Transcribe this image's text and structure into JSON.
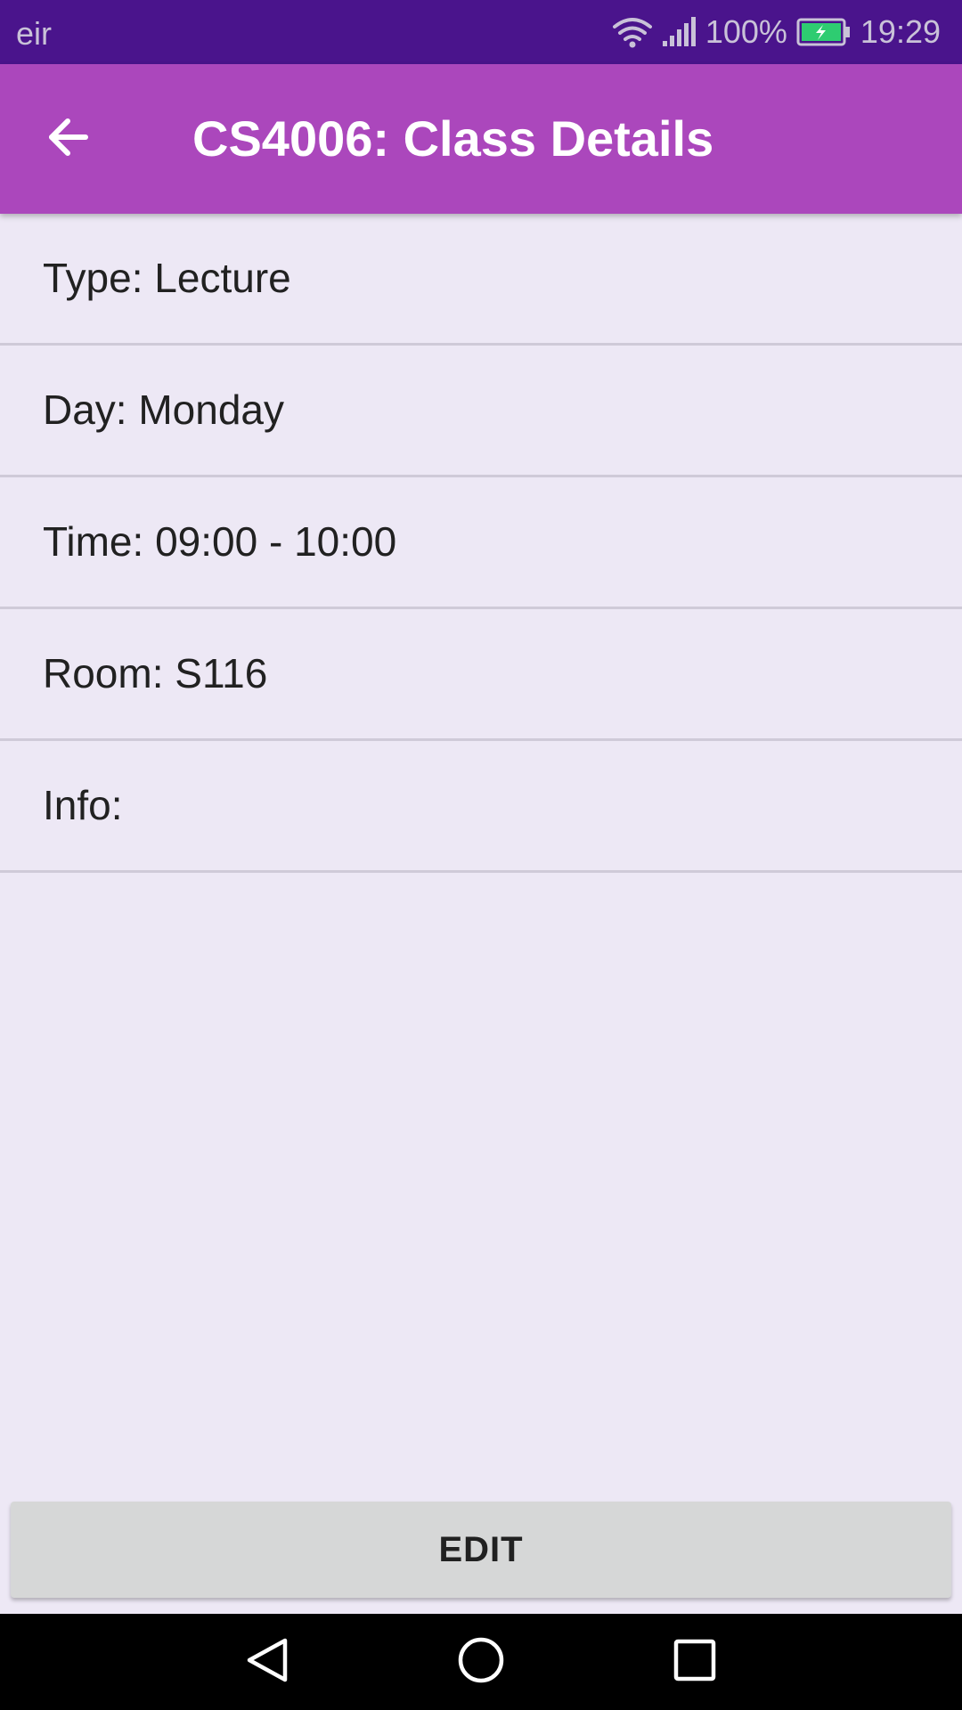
{
  "status_bar": {
    "carrier": "eir",
    "battery_percent": "100%",
    "time": "19:29",
    "icons": [
      "wifi-icon",
      "signal-icon",
      "battery-charging-icon"
    ],
    "battery_color": "#2ecc71"
  },
  "app_bar": {
    "title": "CS4006: Class Details",
    "back_icon": "arrow-back-icon",
    "color": "#ab47bc"
  },
  "details": {
    "items": [
      {
        "label": "Type: Lecture"
      },
      {
        "label": "Day: Monday"
      },
      {
        "label": "Time: 09:00 - 10:00"
      },
      {
        "label": "Room: S116"
      },
      {
        "label": "Info:"
      }
    ]
  },
  "actions": {
    "edit_label": "EDIT"
  },
  "nav_bar": {
    "icons": [
      "nav-back-icon",
      "nav-home-icon",
      "nav-recents-icon"
    ]
  },
  "colors": {
    "status_bar": "#4a148c",
    "background": "#ede8f5",
    "button": "#d6d7d7"
  }
}
